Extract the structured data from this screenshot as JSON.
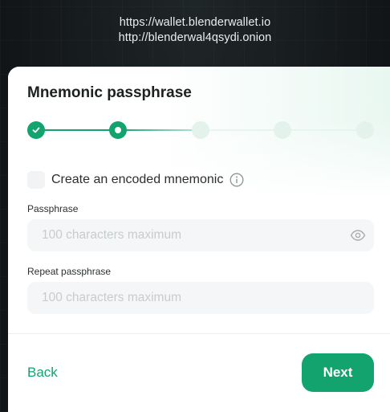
{
  "header": {
    "url_clearnet": "https://wallet.blenderwallet.io",
    "url_onion": "http://blenderwal4qsydi.onion"
  },
  "dialog": {
    "title": "Mnemonic passphrase",
    "stepper": {
      "total_steps": 5,
      "completed_steps": 1,
      "current_step": 2
    },
    "encoded_mnemonic": {
      "label": "Create an encoded mnemonic",
      "checked": false
    },
    "passphrase": {
      "label": "Passphrase",
      "placeholder": "100 characters maximum",
      "value": ""
    },
    "repeat_passphrase": {
      "label": "Repeat passphrase",
      "placeholder": "100 characters maximum",
      "value": ""
    },
    "back_label": "Back",
    "next_label": "Next"
  },
  "colors": {
    "accent": "#12a36f",
    "background": "#15191b",
    "card": "#ffffff"
  },
  "icons": {
    "check": "check-icon",
    "info": "info-icon",
    "eye": "eye-icon"
  }
}
